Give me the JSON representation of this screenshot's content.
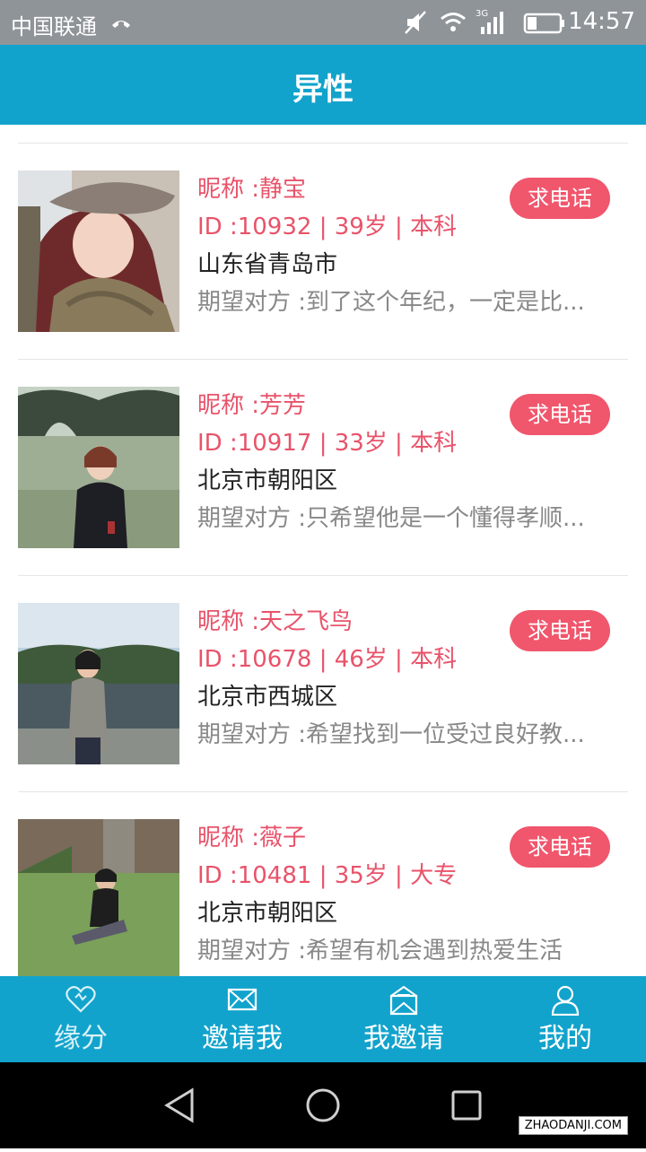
{
  "status_bar": {
    "carrier": "中国联通",
    "time": "14:57",
    "network_type": "3G"
  },
  "header": {
    "title": "异性"
  },
  "profiles": [
    {
      "nickname": "昵称 :静宝",
      "details": "ID :10932 | 39岁 | 本科",
      "location": "山东省青岛市",
      "expectation": "期望对方 :到了这个年纪，一定是比...",
      "button": "求电话"
    },
    {
      "nickname": "昵称 :芳芳",
      "details": "ID :10917 | 33岁 | 本科",
      "location": "北京市朝阳区",
      "expectation": "期望对方 :只希望他是一个懂得孝顺...",
      "button": "求电话"
    },
    {
      "nickname": "昵称 :天之飞鸟",
      "details": "ID :10678 | 46岁 | 本科",
      "location": "北京市西城区",
      "expectation": "期望对方 :希望找到一位受过良好教...",
      "button": "求电话"
    },
    {
      "nickname": "昵称 :薇子",
      "details": "ID :10481 | 35岁 | 大专",
      "location": "北京市朝阳区",
      "expectation": "期望对方 :希望有机会遇到热爱生活",
      "button": "求电话"
    }
  ],
  "tabs": [
    {
      "label": "缘分",
      "icon": "heart-icon"
    },
    {
      "label": "邀请我",
      "icon": "envelope-icon"
    },
    {
      "label": "我邀请",
      "icon": "open-envelope-icon"
    },
    {
      "label": "我的",
      "icon": "person-icon"
    }
  ],
  "watermark": "ZHAODANJI.COM",
  "colors": {
    "primary": "#12a3cc",
    "accent": "#f0566c",
    "status_bar": "#8f9499"
  }
}
